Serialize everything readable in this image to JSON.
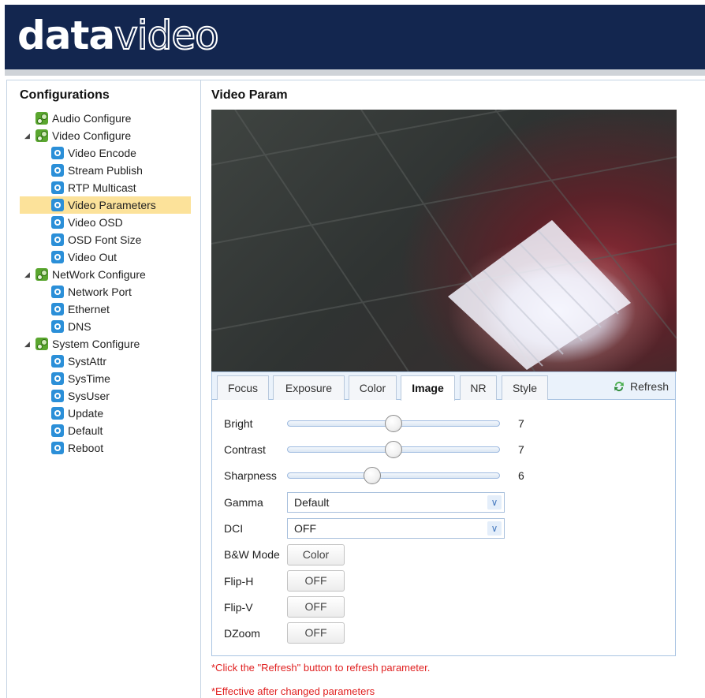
{
  "header": {
    "logo_bold": "data",
    "logo_outline": "video"
  },
  "sidebar": {
    "title": "Configurations",
    "tree": [
      {
        "label": "Audio Configure",
        "level": 0,
        "icon": "group-gear-icon",
        "expandable": false
      },
      {
        "label": "Video Configure",
        "level": 0,
        "icon": "group-gear-icon",
        "expandable": true,
        "expanded": true
      },
      {
        "label": "Video Encode",
        "level": 1,
        "icon": "gear-icon"
      },
      {
        "label": "Stream Publish",
        "level": 1,
        "icon": "gear-icon"
      },
      {
        "label": "RTP Multicast",
        "level": 1,
        "icon": "gear-icon"
      },
      {
        "label": "Video Parameters",
        "level": 1,
        "icon": "gear-icon",
        "selected": true
      },
      {
        "label": "Video OSD",
        "level": 1,
        "icon": "gear-icon"
      },
      {
        "label": "OSD Font Size",
        "level": 1,
        "icon": "gear-icon"
      },
      {
        "label": "Video Out",
        "level": 1,
        "icon": "gear-icon"
      },
      {
        "label": "NetWork Configure",
        "level": 0,
        "icon": "group-gear-icon",
        "expandable": true,
        "expanded": true
      },
      {
        "label": "Network Port",
        "level": 1,
        "icon": "gear-icon"
      },
      {
        "label": "Ethernet",
        "level": 1,
        "icon": "gear-icon"
      },
      {
        "label": "DNS",
        "level": 1,
        "icon": "gear-icon"
      },
      {
        "label": "System Configure",
        "level": 0,
        "icon": "group-gear-icon",
        "expandable": true,
        "expanded": true
      },
      {
        "label": "SystAttr",
        "level": 1,
        "icon": "gear-icon"
      },
      {
        "label": "SysTime",
        "level": 1,
        "icon": "gear-icon"
      },
      {
        "label": "SysUser",
        "level": 1,
        "icon": "gear-icon"
      },
      {
        "label": "Update",
        "level": 1,
        "icon": "gear-icon"
      },
      {
        "label": "Default",
        "level": 1,
        "icon": "gear-icon"
      },
      {
        "label": "Reboot",
        "level": 1,
        "icon": "gear-icon"
      }
    ]
  },
  "main": {
    "title": "Video Param",
    "tabs": [
      {
        "label": "Focus",
        "active": false
      },
      {
        "label": "Exposure",
        "active": false
      },
      {
        "label": "Color",
        "active": false
      },
      {
        "label": "Image",
        "active": true
      },
      {
        "label": "NR",
        "active": false
      },
      {
        "label": "Style",
        "active": false
      }
    ],
    "refresh_label": "Refresh",
    "sliders": [
      {
        "label": "Bright",
        "value": "7",
        "position": 0.5
      },
      {
        "label": "Contrast",
        "value": "7",
        "position": 0.5
      },
      {
        "label": "Sharpness",
        "value": "6",
        "position": 0.4
      }
    ],
    "selects": [
      {
        "label": "Gamma",
        "value": "Default"
      },
      {
        "label": "DCI",
        "value": "OFF"
      }
    ],
    "buttons": [
      {
        "label": "B&W Mode",
        "value": "Color"
      },
      {
        "label": "Flip-H",
        "value": "OFF"
      },
      {
        "label": "Flip-V",
        "value": "OFF"
      },
      {
        "label": "DZoom",
        "value": "OFF"
      }
    ],
    "notes": [
      "*Click the \"Refresh\" button to refresh parameter.",
      "*Effective after changed parameters"
    ]
  },
  "colors": {
    "banner": "#13264f",
    "selected_highlight": "#fce29a",
    "note_red": "#e02020",
    "tab_border": "#a9c4e2"
  }
}
